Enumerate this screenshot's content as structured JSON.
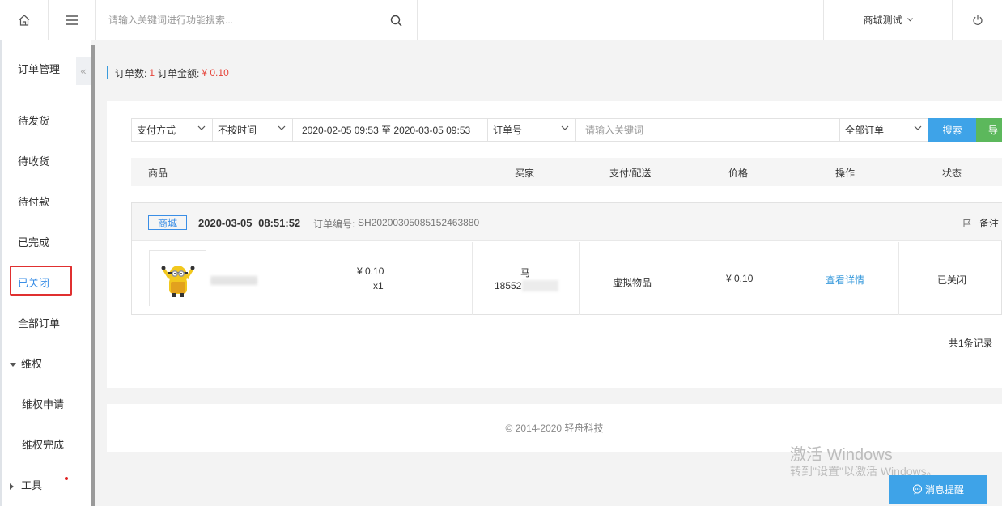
{
  "topbar": {
    "search_placeholder": "请输入关键词进行功能搜索...",
    "store_name": "商城测试"
  },
  "sidebar": {
    "title": "订单管理",
    "items": [
      "待发货",
      "待收货",
      "待付款",
      "已完成",
      "已关闭",
      "全部订单"
    ],
    "rights_group": "维权",
    "rights_items": [
      "维权申请",
      "维权完成"
    ],
    "tools_group": "工具"
  },
  "summary": {
    "count_label": "订单数:",
    "count_value": "1",
    "amount_label": "订单金额:",
    "amount_value": "¥ 0.10"
  },
  "filters": {
    "payment": "支付方式",
    "time": "不按时间",
    "date_range": "2020-02-05 09:53 至 2020-03-05 09:53",
    "field": "订单号",
    "keyword_placeholder": "请输入关键词",
    "status": "全部订单",
    "search_button": "搜索",
    "export_button": "导"
  },
  "table": {
    "headers": [
      "商品",
      "买家",
      "支付/配送",
      "价格",
      "操作",
      "状态"
    ]
  },
  "order": {
    "tag": "商城",
    "datetime": "2020-03-05 08:51:52",
    "order_no_label": "订单编号:",
    "order_no": "SH20200305085152463880",
    "note": "备注",
    "unit_price": "¥ 0.10",
    "quantity": "x1",
    "buyer_name": "马",
    "buyer_phone": "18552",
    "delivery": "虚拟物品",
    "price": "¥ 0.10",
    "action": "查看详情",
    "status": "已关闭"
  },
  "pager": {
    "total": "共1条记录"
  },
  "footer": {
    "copyright": "© 2014-2020 轻舟科技"
  },
  "watermark": {
    "line1": "激活 Windows",
    "line2": "转到\"设置\"以激活 Windows。"
  },
  "message_button": "消息提醒",
  "colors": {
    "accent": "#3a9bdc",
    "highlight": "#e03030",
    "search": "#3ea3e8",
    "export": "#5cb85c",
    "price_red": "#e6443a"
  }
}
